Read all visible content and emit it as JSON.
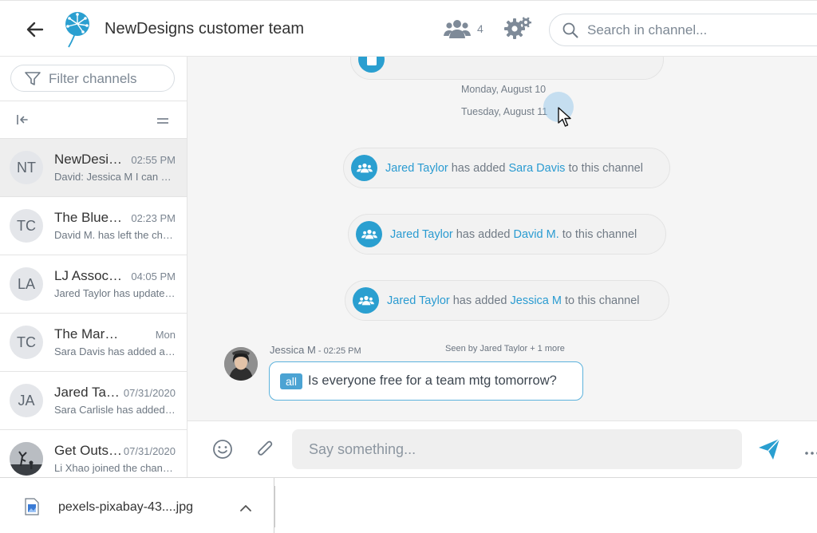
{
  "header": {
    "title": "NewDesigns customer team",
    "member_count": "4",
    "search_placeholder": "Search in channel..."
  },
  "sidebar": {
    "filter_placeholder": "Filter channels",
    "conversations": [
      {
        "initials": "NT",
        "name": "NewDesigns customer team",
        "time": "02:55 PM",
        "preview": "David: Jessica M I can make it"
      },
      {
        "initials": "TC",
        "name": "The Blue Team",
        "time": "02:23 PM",
        "preview": "David M. has left the channel"
      },
      {
        "initials": "LA",
        "name": "LJ Associates",
        "time": "04:05 PM",
        "preview": "Jared Taylor has updated the wiki"
      },
      {
        "initials": "TC",
        "name": "The Market Team",
        "time": "Mon",
        "preview": "Sara Davis has added a member"
      },
      {
        "initials": "JA",
        "name": "Jared Taylor",
        "time": "07/31/2020",
        "preview": "Sara Carlisle has added a member"
      },
      {
        "initials": "",
        "name": "Get Outside",
        "time": "07/31/2020",
        "preview": "Li Xhao joined the channel"
      }
    ]
  },
  "chat": {
    "dates": [
      "Monday, August 10",
      "Tuesday, August 11"
    ],
    "system_messages": [
      {
        "actor": "Jared Taylor",
        "verb": " has added ",
        "target": "Sara Davis",
        "suffix": " to this channel"
      },
      {
        "actor": "Jared Taylor",
        "verb": " has added ",
        "target": "David M.",
        "suffix": " to this channel"
      },
      {
        "actor": "Jared Taylor",
        "verb": " has added ",
        "target": "Jessica M",
        "suffix": " to this channel"
      }
    ],
    "message": {
      "author": "Jessica M",
      "time": " - 02:25 PM",
      "seen": "Seen by Jared Taylor + 1 more",
      "mention": "all",
      "text": "Is everyone free for a team mtg tomorrow?"
    }
  },
  "composer": {
    "placeholder": "Say something..."
  },
  "download_bar": {
    "file_name": "pexels-pixabay-43....jpg"
  },
  "colors": {
    "accent": "#2a9fd0",
    "link": "#2a9bd1",
    "chat_bg": "#f5f5f5",
    "active_row": "#eeeeee"
  }
}
